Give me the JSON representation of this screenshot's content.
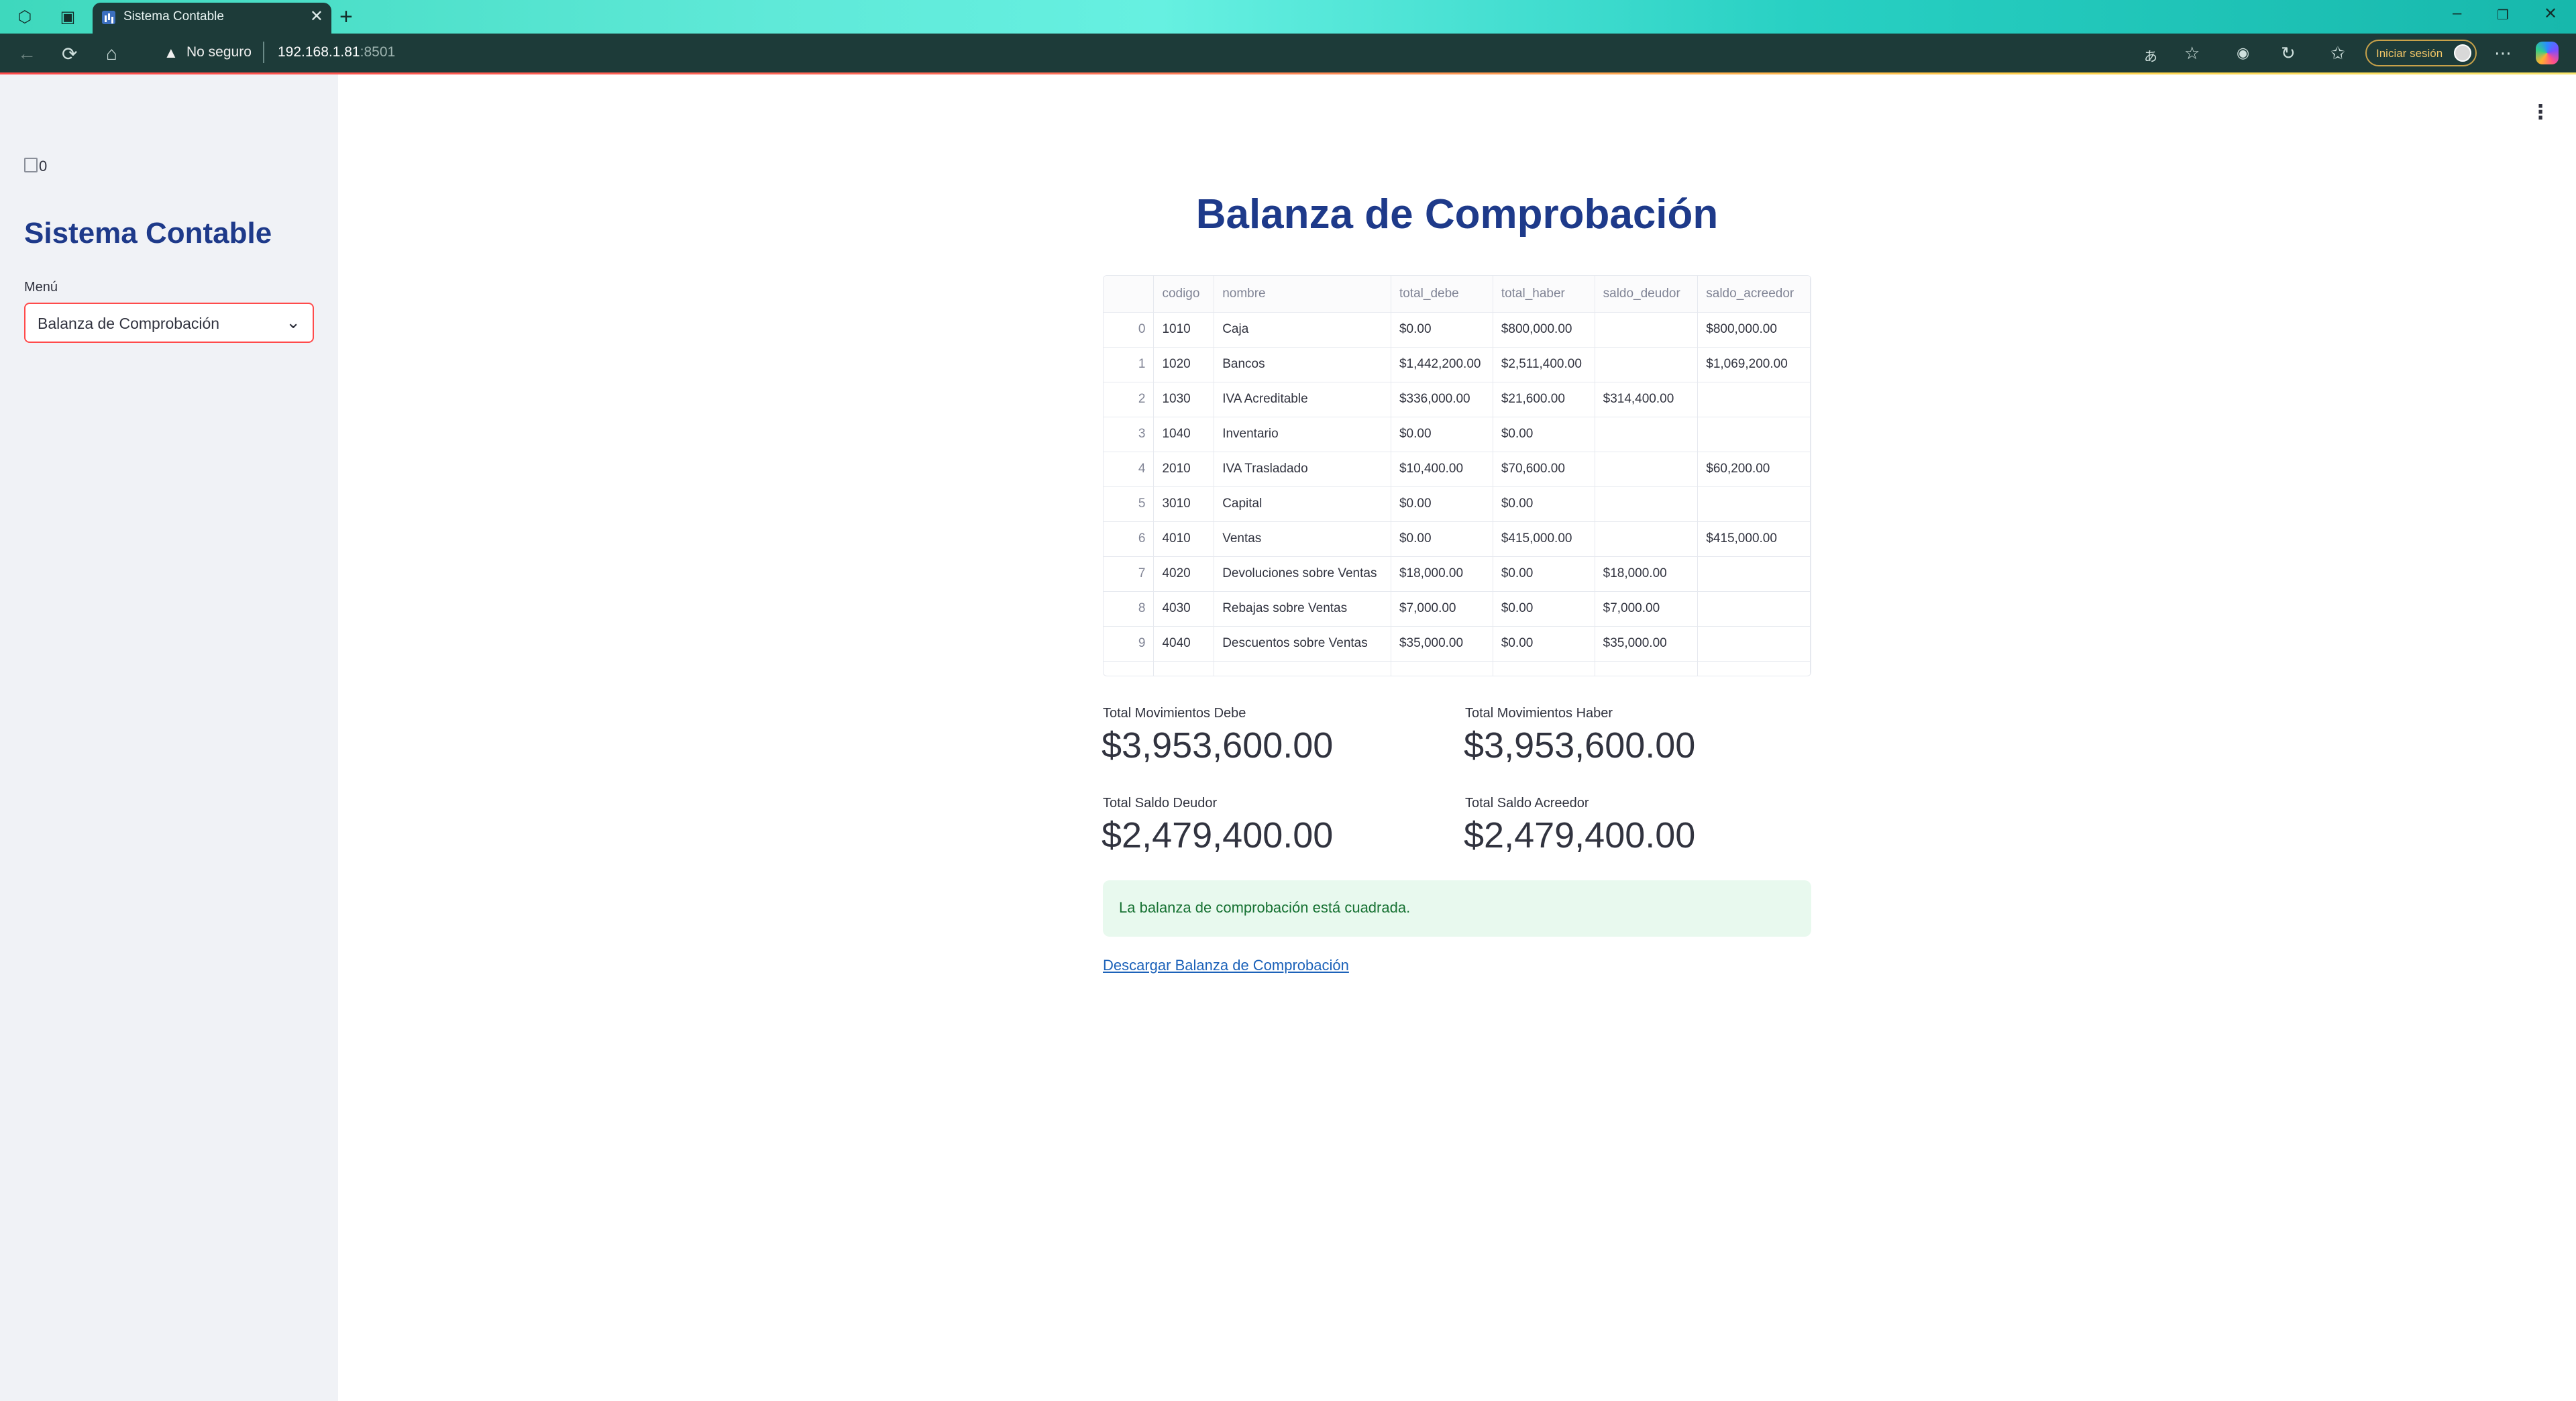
{
  "browser": {
    "tab_title": "Sistema Contable",
    "address_security": "No seguro",
    "address_host": "192.168.1.81",
    "address_port": ":8501",
    "signin_label": "Iniciar sesión"
  },
  "sidebar": {
    "image_alt": "0",
    "title": "Sistema Contable",
    "menu_label": "Menú",
    "menu_value": "Balanza de Comprobación"
  },
  "main": {
    "title": "Balanza de Comprobación",
    "table": {
      "columns": [
        "",
        "codigo",
        "nombre",
        "total_debe",
        "total_haber",
        "saldo_deudor",
        "saldo_acreedor"
      ],
      "rows": [
        [
          "0",
          "1010",
          "Caja",
          "$0.00",
          "$800,000.00",
          "",
          "$800,000.00"
        ],
        [
          "1",
          "1020",
          "Bancos",
          "$1,442,200.00",
          "$2,511,400.00",
          "",
          "$1,069,200.00"
        ],
        [
          "2",
          "1030",
          "IVA Acreditable",
          "$336,000.00",
          "$21,600.00",
          "$314,400.00",
          ""
        ],
        [
          "3",
          "1040",
          "Inventario",
          "$0.00",
          "$0.00",
          "",
          ""
        ],
        [
          "4",
          "2010",
          "IVA Trasladado",
          "$10,400.00",
          "$70,600.00",
          "",
          "$60,200.00"
        ],
        [
          "5",
          "3010",
          "Capital",
          "$0.00",
          "$0.00",
          "",
          ""
        ],
        [
          "6",
          "4010",
          "Ventas",
          "$0.00",
          "$415,000.00",
          "",
          "$415,000.00"
        ],
        [
          "7",
          "4020",
          "Devoluciones sobre Ventas",
          "$18,000.00",
          "$0.00",
          "$18,000.00",
          ""
        ],
        [
          "8",
          "4030",
          "Rebajas sobre Ventas",
          "$7,000.00",
          "$0.00",
          "$7,000.00",
          ""
        ],
        [
          "9",
          "4040",
          "Descuentos sobre Ventas",
          "$35,000.00",
          "$0.00",
          "$35,000.00",
          ""
        ]
      ]
    },
    "metrics": {
      "debe_label": "Total Movimientos Debe",
      "debe_value": "$3,953,600.00",
      "haber_label": "Total Movimientos Haber",
      "haber_value": "$3,953,600.00",
      "deudor_label": "Total Saldo Deudor",
      "deudor_value": "$2,479,400.00",
      "acreedor_label": "Total Saldo Acreedor",
      "acreedor_value": "$2,479,400.00"
    },
    "alert": "La balanza de comprobación está cuadrada.",
    "download_link": "Descargar Balanza de Comprobación"
  },
  "colors": {
    "accent_red": "#ff4b4b",
    "title_blue": "#1e3a8a",
    "success_bg": "#e8f9ee",
    "success_text": "#177233",
    "link_blue": "#1c62b9"
  }
}
